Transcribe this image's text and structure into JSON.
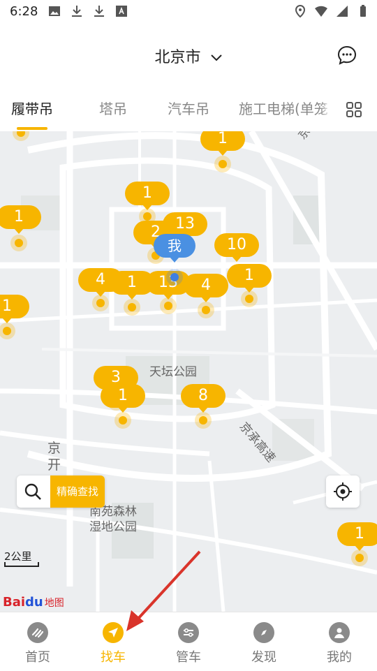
{
  "status_bar": {
    "time": "6:28"
  },
  "header": {
    "city": "北京市"
  },
  "tabs": [
    {
      "label": "履带吊",
      "active": true
    },
    {
      "label": "塔吊",
      "active": false
    },
    {
      "label": "汽车吊",
      "active": false
    },
    {
      "label": "施工电梯(单笼",
      "active": false
    }
  ],
  "map": {
    "pins": [
      "1",
      "1",
      "1",
      "2",
      "13",
      "10",
      "1",
      "4",
      "1",
      "13",
      "4",
      "1",
      "3",
      "1",
      "8",
      "1"
    ],
    "me_label": "我",
    "labels": {
      "park": "天坛公园",
      "district": "京开",
      "nanyuan": "南苑森林湿地公园",
      "expressway": "京承高速",
      "expressway2": "京哈高速"
    },
    "search_label": "精确查找",
    "scale": "2公里",
    "logo": {
      "bai": "Bai",
      "du": "du",
      "map": "地图"
    }
  },
  "bottom_nav": [
    {
      "label": "首页",
      "icon": "home-icon",
      "active": false
    },
    {
      "label": "找车",
      "icon": "find-car-icon",
      "active": true
    },
    {
      "label": "管车",
      "icon": "manage-car-icon",
      "active": false
    },
    {
      "label": "发现",
      "icon": "discover-icon",
      "active": false
    },
    {
      "label": "我的",
      "icon": "profile-icon",
      "active": false
    }
  ],
  "colors": {
    "accent": "#f7b500",
    "me": "#4a90e2",
    "arrow": "#d9342b"
  }
}
